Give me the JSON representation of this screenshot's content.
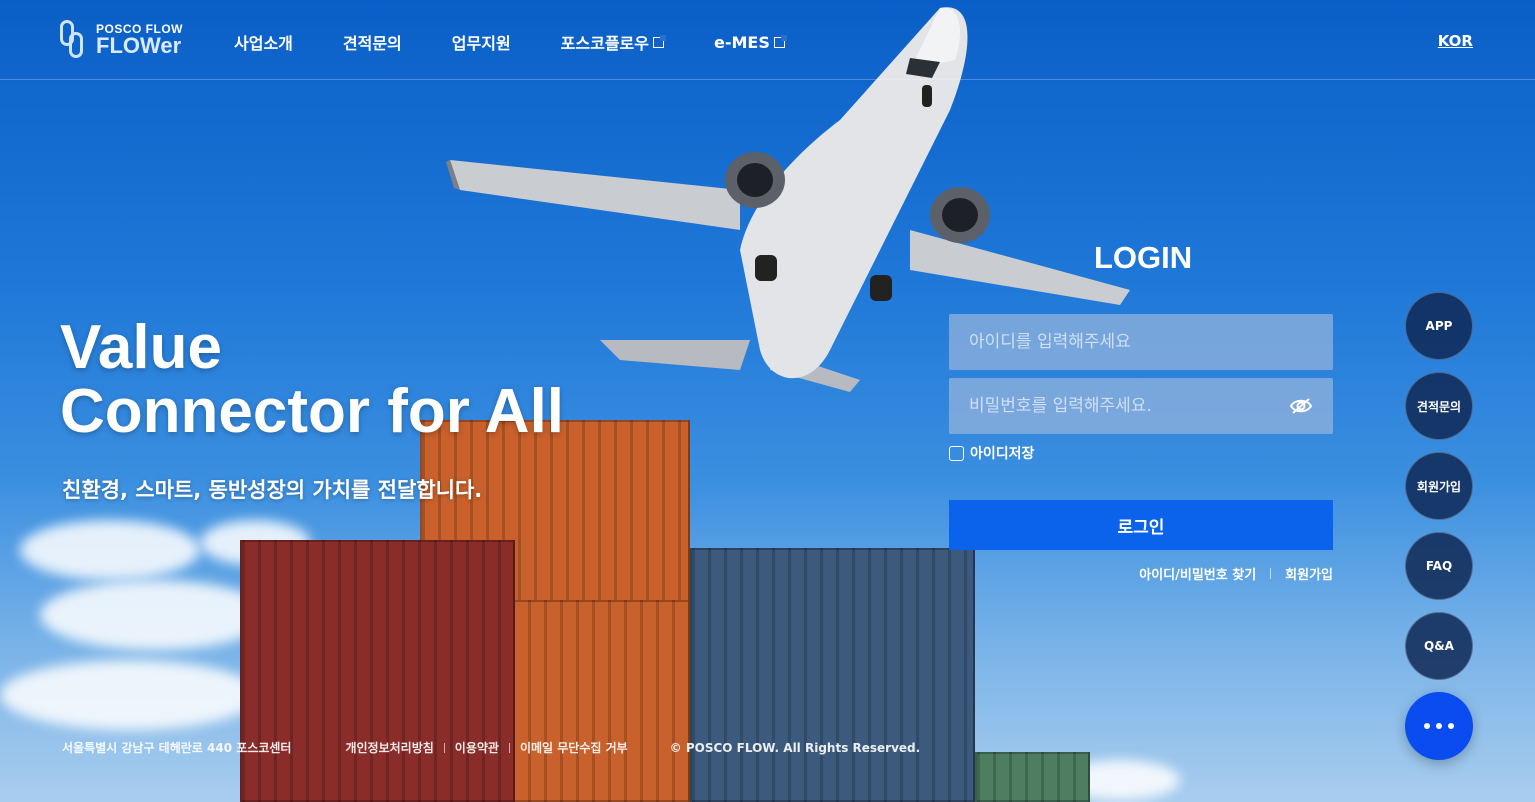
{
  "header": {
    "logo_small": "POSCO FLOW",
    "logo_big": "FLOWer",
    "nav": [
      {
        "label": "사업소개"
      },
      {
        "label": "견적문의"
      },
      {
        "label": "업무지원"
      },
      {
        "label": "포스코플로우"
      },
      {
        "label": "e-MES"
      }
    ],
    "lang": "KOR"
  },
  "hero": {
    "title_line1": "Value",
    "title_line2": "Connector for All",
    "subtitle": "친환경, 스마트, 동반성장의 가치를 전달합니다."
  },
  "login": {
    "title": "LOGIN",
    "id_placeholder": "아이디를 입력해주세요",
    "pw_placeholder": "비밀번호를 입력해주세요.",
    "save_id_label": "아이디저장",
    "submit_label": "로그인",
    "find_label": "아이디/비밀번호 찾기",
    "join_label": "회원가입"
  },
  "quick_menu": [
    {
      "label": "APP"
    },
    {
      "label": "견적문의"
    },
    {
      "label": "회원가입"
    },
    {
      "label": "FAQ"
    },
    {
      "label": "Q&A"
    }
  ],
  "footer": {
    "address": "서울특별시 강남구 테헤란로 440 포스코센터",
    "links": [
      "개인정보처리방침",
      "이용약관",
      "이메일 무단수집 거부"
    ],
    "copyright": "© POSCO FLOW. All Rights Reserved."
  },
  "colors": {
    "accent": "#0a63ea",
    "quick_more": "#0b4cf0"
  }
}
